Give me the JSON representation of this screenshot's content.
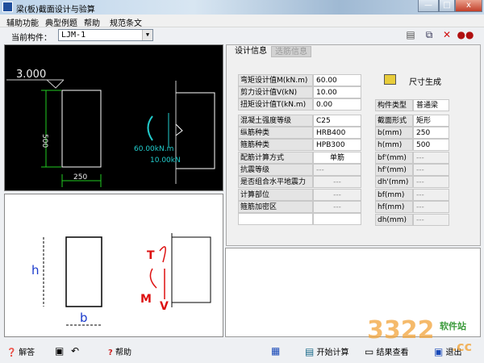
{
  "window": {
    "title": "梁(板)截面设计与验算",
    "minimize": "—",
    "maximize": "□",
    "close": "x"
  },
  "menu": [
    "辅助功能",
    "典型例题",
    "帮助",
    "规范条文"
  ],
  "component": {
    "label": "当前构件：",
    "value": "LJM-1"
  },
  "drawing": {
    "elevation": "3.000",
    "height_dim": "500",
    "width_dim": "250",
    "moment": "60.00kN.m",
    "shear": "10.00kN"
  },
  "sketch": {
    "h": "h",
    "b": "b",
    "T": "T",
    "M": "M",
    "V": "V"
  },
  "tabs": {
    "design": "设计信息",
    "rebar": "选筋信息"
  },
  "loads": [
    {
      "label": "弯矩设计值M(kN.m)",
      "value": "60.00"
    },
    {
      "label": "剪力设计值V(kN)",
      "value": "10.00"
    },
    {
      "label": "扭矩设计值T(kN.m)",
      "value": "0.00"
    }
  ],
  "materials": [
    {
      "label": "混凝土强度等级",
      "value": "C25"
    },
    {
      "label": "纵筋种类",
      "value": "HRB400"
    },
    {
      "label": "箍筋种类",
      "value": "HPB300"
    },
    {
      "label": "配筋计算方式",
      "value": "单筋"
    },
    {
      "label": "抗震等级",
      "value": "---"
    },
    {
      "label": "是否组合水平地震力",
      "value": "---"
    },
    {
      "label": "计算部位",
      "value": "---"
    },
    {
      "label": "箍筋加密区",
      "value": "---"
    }
  ],
  "size_gen": "尺寸生成",
  "member_type": {
    "label": "构件类型",
    "value": "普通梁"
  },
  "section": [
    {
      "label": "截面形式",
      "value": "矩形"
    },
    {
      "label": "b(mm)",
      "value": "250"
    },
    {
      "label": "h(mm)",
      "value": "500"
    },
    {
      "label": "bf'(mm)",
      "value": "---"
    },
    {
      "label": "hf'(mm)",
      "value": "---"
    },
    {
      "label": "dh'(mm)",
      "value": "---"
    },
    {
      "label": "bf(mm)",
      "value": "---"
    },
    {
      "label": "hf(mm)",
      "value": "---"
    },
    {
      "label": "dh(mm)",
      "value": "---"
    }
  ],
  "bottom": {
    "answer": "解答",
    "help": "帮助",
    "calc": "开始计算",
    "results": "结果查看",
    "exit": "退出"
  },
  "watermark": {
    "main": "3322",
    "sub": "软件站",
    "cc": ".cc"
  }
}
